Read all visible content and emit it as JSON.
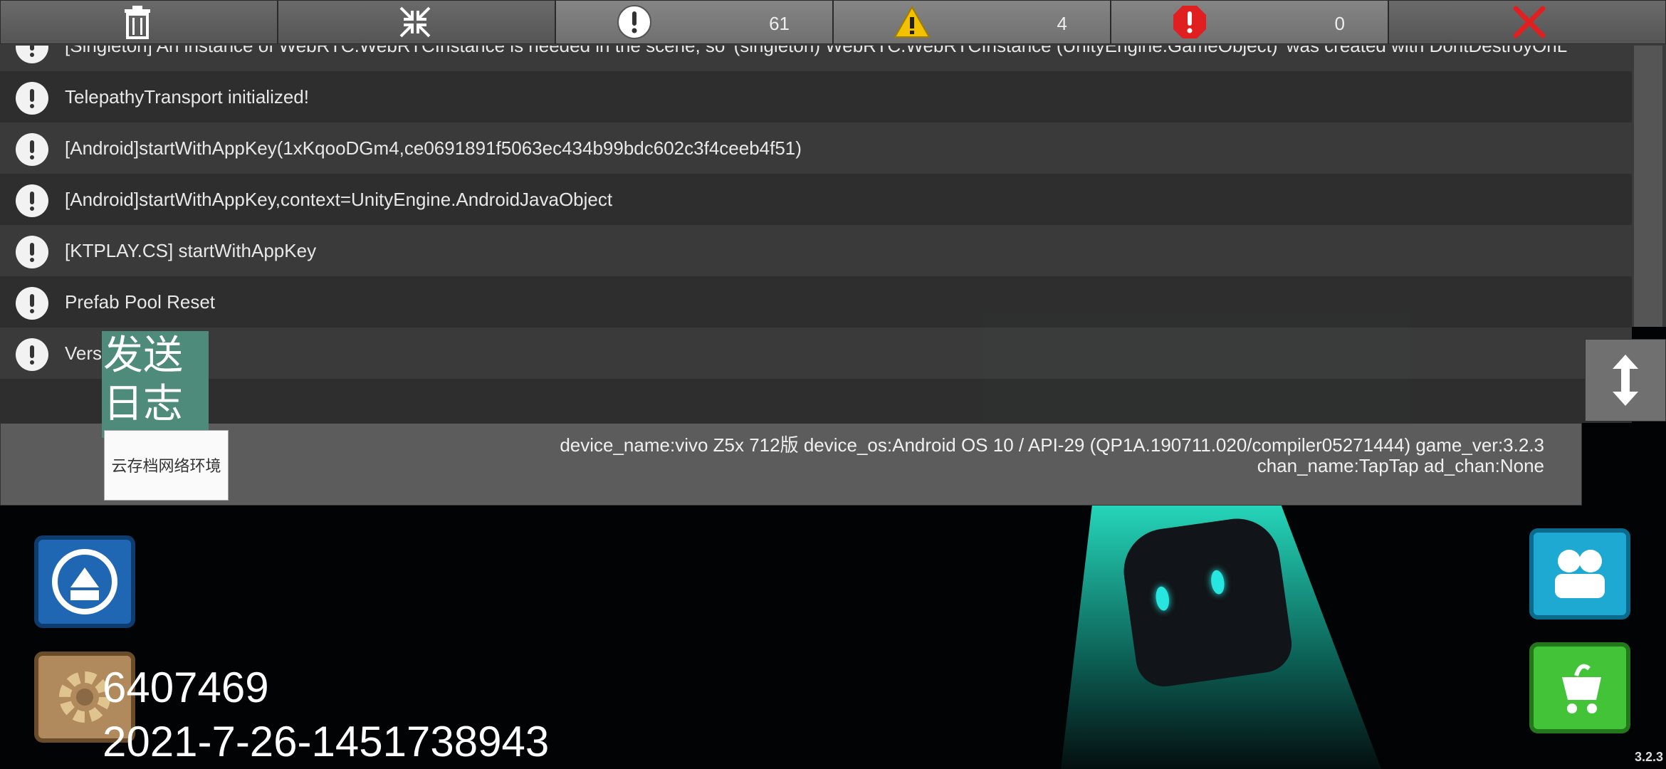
{
  "toolbar": {
    "buttons": [
      {
        "icon": "trash-icon"
      },
      {
        "icon": "collapse-icon"
      },
      {
        "icon": "info-icon",
        "count": "61"
      },
      {
        "icon": "warning-icon",
        "count": "4"
      },
      {
        "icon": "error-icon",
        "count": "0"
      },
      {
        "icon": "close-icon"
      }
    ]
  },
  "log": {
    "entries": [
      "[Singleton] An instance of WebRTC.WebRTCInstance is needed in the scene, so '(singleton) WebRTC.WebRTCInstance (UnityEngine.GameObject)' was created with DontDestroyOnL",
      "TelepathyTransport initialized!",
      "[Android]startWithAppKey(1xKqooDGm4,ce0691891f5063ec434b99bdc602c3f4ceeb4f51)",
      "[Android]startWithAppKey,context=UnityEngine.AndroidJavaObject",
      "[KTPLAY.CS] startWithAppKey",
      "Prefab Pool Reset",
      "Vers"
    ]
  },
  "info": {
    "line1": "device_name:vivo Z5x 712版    device_os:Android OS 10 / API-29 (QP1A.190711.020/compiler05271444)    game_ver:3.2.3",
    "line2": "chan_name:TapTap    ad_chan:None"
  },
  "send_log_label": "发送\n日志",
  "cloud_label": "云存档网络环境",
  "uid": "6407469",
  "build_stamp": "2021-7-26-1451738943",
  "corner_version": "3.2.3",
  "colors": {
    "send_log_bg": "#4f8b7a",
    "warning": "#f2c200",
    "error": "#e02020"
  }
}
